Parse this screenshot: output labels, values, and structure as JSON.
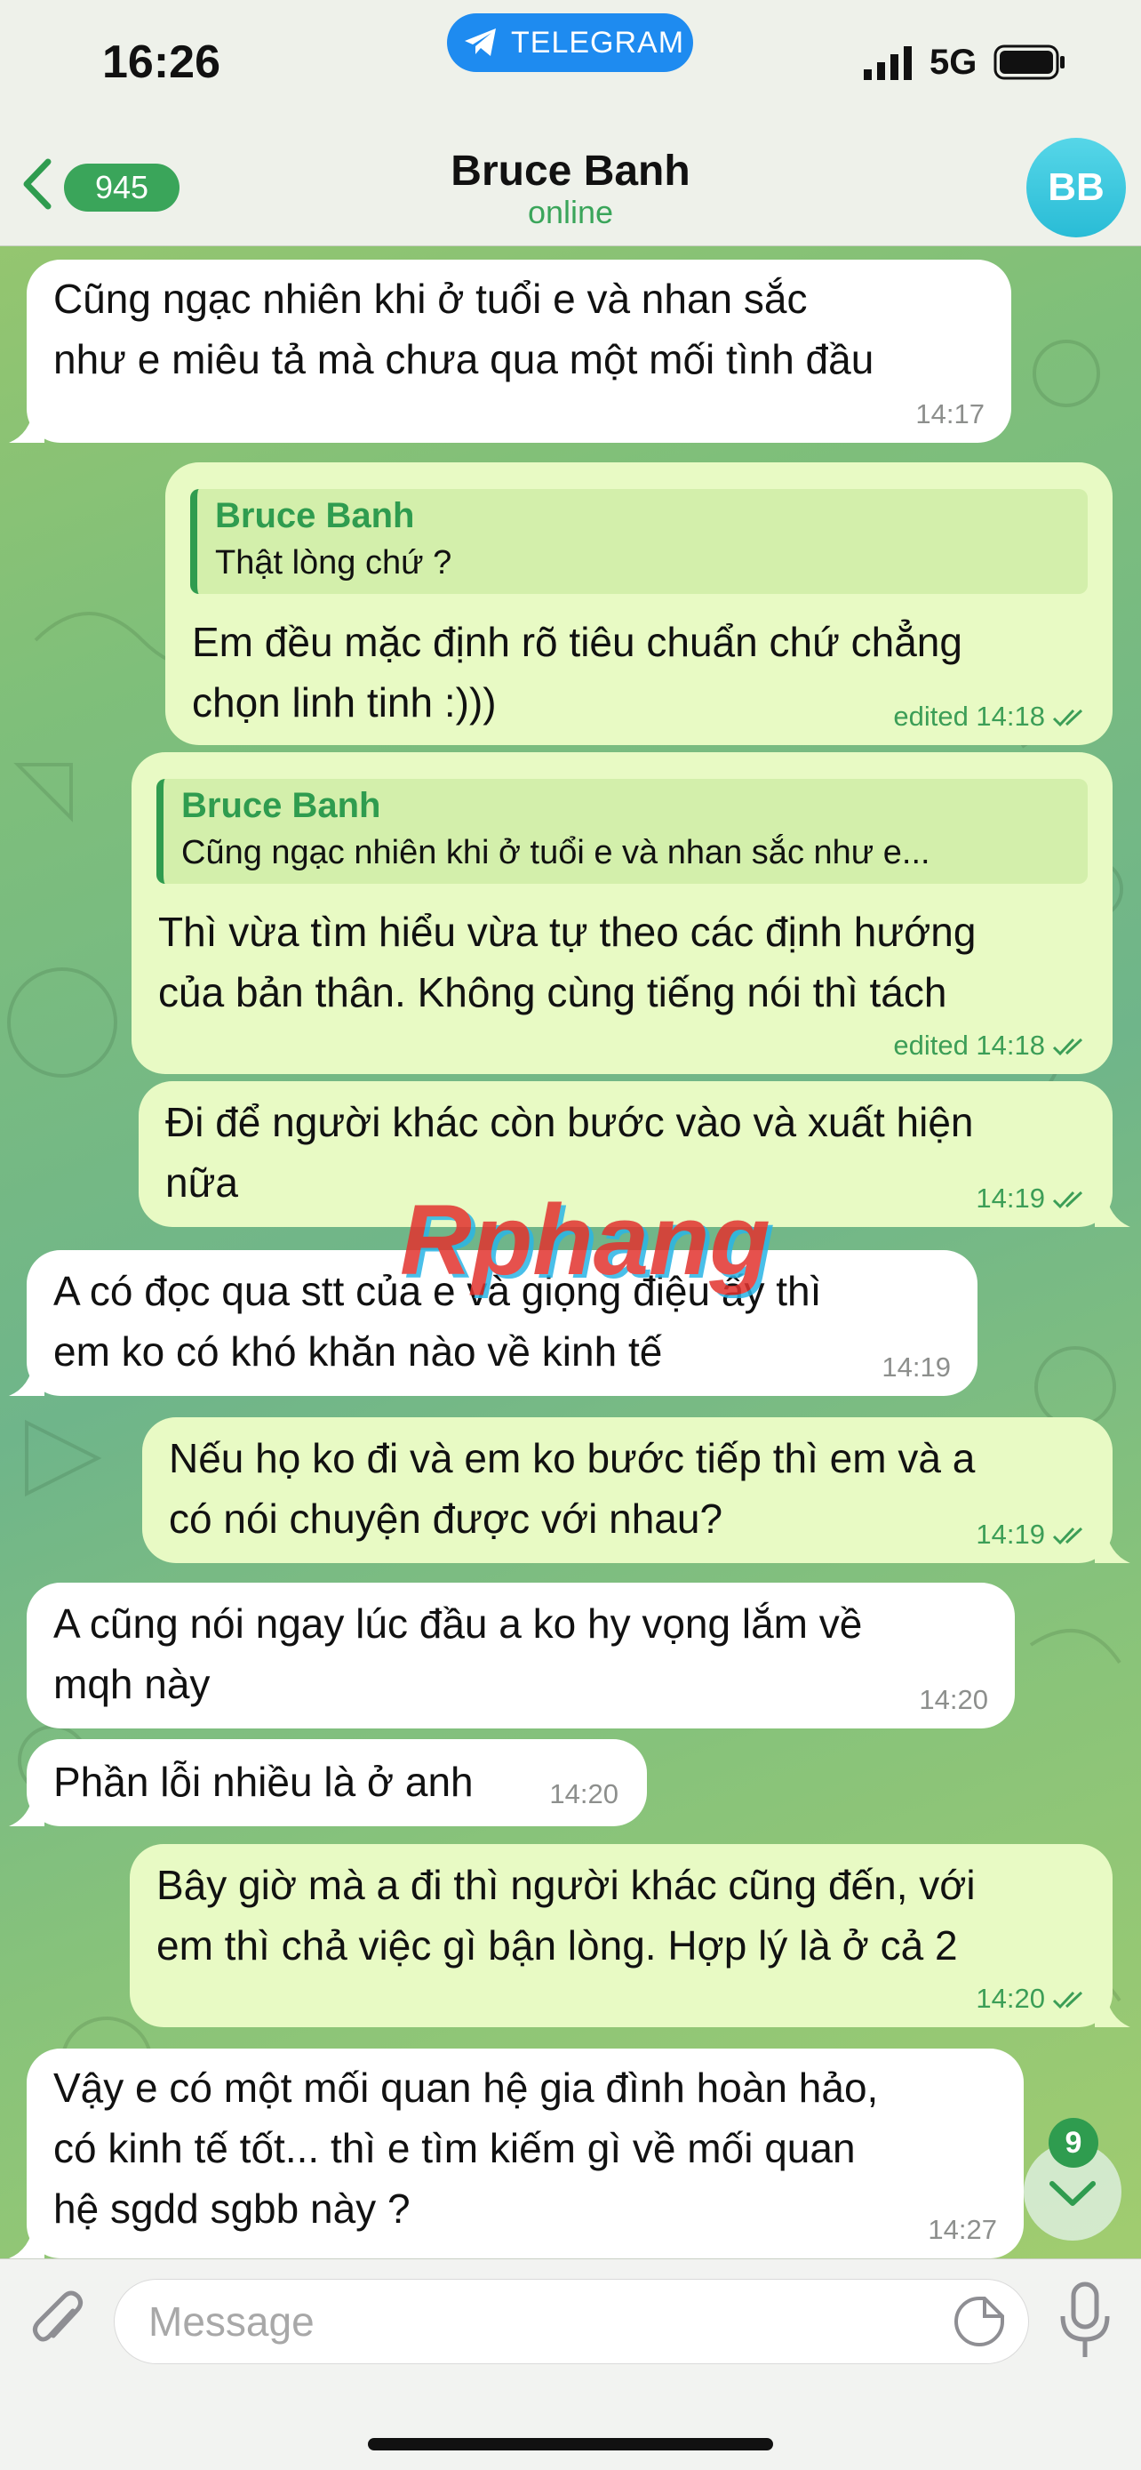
{
  "status_bar": {
    "time": "16:26",
    "telegram_label": "TELEGRAM",
    "network": "5G"
  },
  "header": {
    "back_count": "945",
    "contact_name": "Bruce Banh",
    "contact_status": "online",
    "avatar_initials": "BB"
  },
  "messages": [
    {
      "side": "in",
      "text": "Cũng ngạc nhiên khi ở tuổi e và nhan sắc\nnhư e miêu tả mà chưa qua một mối tình đầu",
      "time": "14:17"
    },
    {
      "side": "out",
      "reply_name": "Bruce Banh",
      "reply_text": "Thật lòng chứ ?",
      "text": "Em đều mặc định rõ tiêu chuẩn chứ chẳng\nchọn linh tinh :)))",
      "time": "edited 14:18"
    },
    {
      "side": "out",
      "reply_name": "Bruce Banh",
      "reply_text": "Cũng ngạc nhiên khi ở tuổi e và nhan sắc như e...",
      "text": "Thì vừa tìm hiểu vừa tự theo các định hướng\ncủa bản thân. Không cùng tiếng nói thì tách",
      "time": "edited 14:18"
    },
    {
      "side": "out",
      "text": "Đi để người khác còn bước vào và xuất hiện\nnữa",
      "time": "14:19"
    },
    {
      "side": "in",
      "text": "A có đọc qua stt của e và giọng điệu ấy thì\nem ko có khó khăn nào về kinh tế",
      "time": "14:19"
    },
    {
      "side": "out",
      "text": "Nếu họ ko đi và em ko bước tiếp thì em và a\ncó nói chuyện được với nhau?",
      "time": "14:19"
    },
    {
      "side": "in",
      "text": "A cũng nói ngay lúc đầu a ko hy vọng lắm về\nmqh này",
      "time": "14:20"
    },
    {
      "side": "in",
      "text": "Phần lỗi nhiều là ở anh",
      "time": "14:20"
    },
    {
      "side": "out",
      "text": "Bây giờ mà a đi thì người khác cũng đến, với\nem thì chả việc gì bận lòng. Hợp lý là ở cả 2",
      "time": "14:20"
    },
    {
      "side": "in",
      "text": "Vậy e có một mối quan hệ gia đình hoàn hảo,\ncó kinh tế tốt... thì e tìm kiếm gì về mối quan\nhệ sgdd sgbb này ?",
      "time": "14:27"
    }
  ],
  "scroll_down_badge": "9",
  "watermark": "Rphang",
  "composer": {
    "placeholder": "Message",
    "value": ""
  },
  "colors": {
    "incoming_bubble": "#ffffff",
    "outgoing_bubble": "#e8fac4",
    "accent_green": "#2f9c4f",
    "telegram_blue": "#1e8bf0",
    "avatar": "#29bcd6"
  },
  "icons": [
    "telegram-plane-icon",
    "signal-icon",
    "battery-icon",
    "back-chevron-icon",
    "double-check-icon",
    "scroll-down-chevron-icon",
    "attach-icon",
    "sticker-icon",
    "microphone-icon"
  ]
}
